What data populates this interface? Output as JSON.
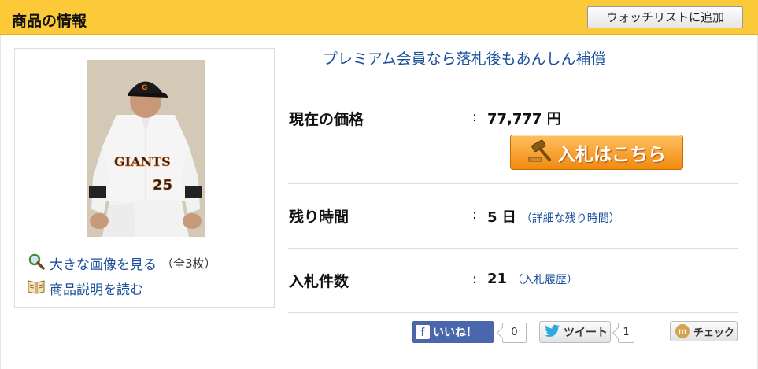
{
  "header": {
    "title": "商品の情報",
    "watchlist_button": "ウォッチリストに追加"
  },
  "image_panel": {
    "photo_alt": "baseball player photo",
    "enlarge_link": "大きな画像を見る",
    "enlarge_note": "（全3枚）",
    "description_link": "商品説明を読む"
  },
  "main": {
    "premium_banner": "プレミアム会員なら落札後もあんしん補償",
    "rows": [
      {
        "label": "現在の価格",
        "colon": ":",
        "value": "77,777 円",
        "sub": ""
      },
      {
        "label": "残り時間",
        "colon": ":",
        "value": "5 日",
        "sub": "（詳細な残り時間）"
      },
      {
        "label": "入札件数",
        "colon": ":",
        "value": "21",
        "sub": "（入札履歴）"
      }
    ],
    "bid_button": "入札はこちら"
  },
  "social": {
    "like_label": "いいね！",
    "like_count": "0",
    "tweet_label": "ツイート",
    "tweet_count": "1",
    "check_label": "チェック"
  },
  "colors": {
    "header_bg": "#fcc938",
    "link": "#1a4f9c",
    "bid_button": "#f08a10",
    "facebook": "#4a67ad"
  }
}
